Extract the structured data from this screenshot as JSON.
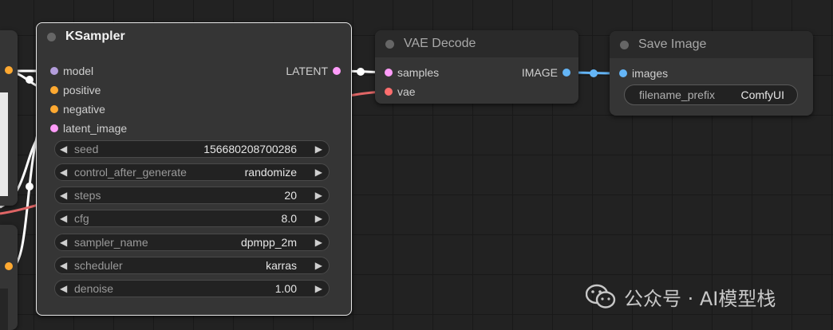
{
  "colors": {
    "model": "#b39ddb",
    "conditioning": "#ffa931",
    "latent": "#ff9cf9",
    "vae": "#ff6e6e",
    "image": "#64b5f6"
  },
  "ksampler": {
    "title": "KSampler",
    "inputs": [
      "model",
      "positive",
      "negative",
      "latent_image"
    ],
    "output": "LATENT",
    "widgets": [
      {
        "label": "seed",
        "value": "156680208700286"
      },
      {
        "label": "control_after_generate",
        "value": "randomize"
      },
      {
        "label": "steps",
        "value": "20"
      },
      {
        "label": "cfg",
        "value": "8.0"
      },
      {
        "label": "sampler_name",
        "value": "dpmpp_2m"
      },
      {
        "label": "scheduler",
        "value": "karras"
      },
      {
        "label": "denoise",
        "value": "1.00"
      }
    ]
  },
  "vae_decode": {
    "title": "VAE Decode",
    "inputs": [
      "samples",
      "vae"
    ],
    "output": "IMAGE"
  },
  "save_image": {
    "title": "Save Image",
    "input": "images",
    "widget": {
      "label": "filename_prefix",
      "value": "ComfyUI"
    }
  },
  "widget_arrows": {
    "left": "◀",
    "right": "▶"
  },
  "watermark": "公众号 · AI模型栈",
  "icons": [
    "node-status-dot-icon",
    "decrement-arrow-icon",
    "increment-arrow-icon",
    "wechat-icon"
  ]
}
